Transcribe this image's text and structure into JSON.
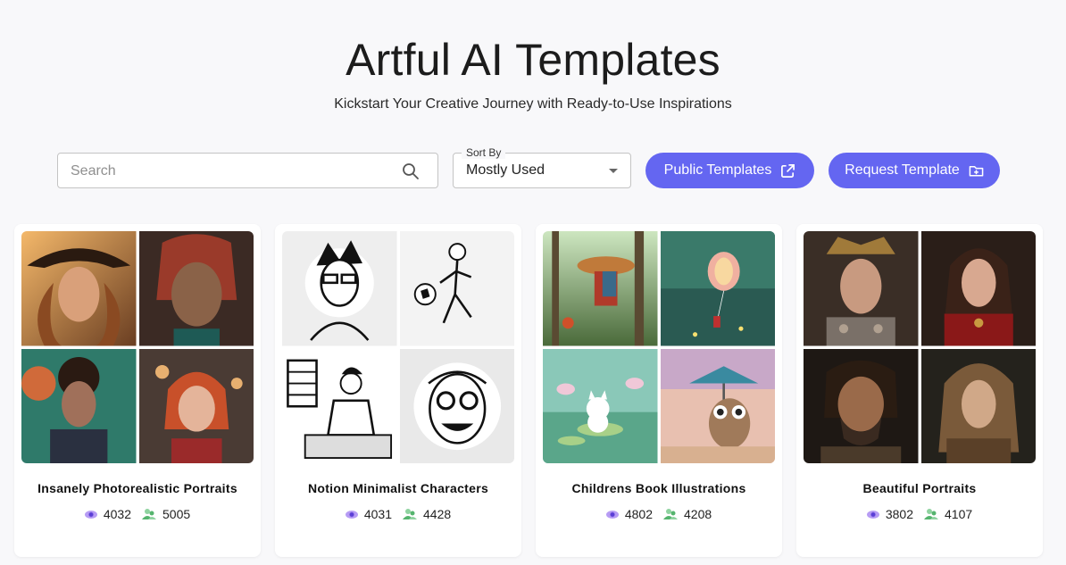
{
  "header": {
    "title": "Artful AI Templates",
    "subtitle": "Kickstart Your Creative Journey with Ready-to-Use Inspirations"
  },
  "search": {
    "placeholder": "Search",
    "value": ""
  },
  "sort": {
    "label": "Sort By",
    "selected": "Mostly Used"
  },
  "buttons": {
    "public_templates": "Public Templates",
    "request_template": "Request Template"
  },
  "icons": {
    "search": "search-icon",
    "external_link": "external-link-icon",
    "folder_add": "folder-plus-icon",
    "views": "eye-icon",
    "uses": "users-icon"
  },
  "colors": {
    "accent": "#6466f1",
    "views_icon": "#9b7cf0",
    "uses_icon": "#55b46e"
  },
  "cards": [
    {
      "title": "Insanely Photorealistic Portraits",
      "views": "4032",
      "uses": "5005"
    },
    {
      "title": "Notion Minimalist Characters",
      "views": "4031",
      "uses": "4428"
    },
    {
      "title": "Childrens Book Illustrations",
      "views": "4802",
      "uses": "4208"
    },
    {
      "title": "Beautiful Portraits",
      "views": "3802",
      "uses": "4107"
    }
  ]
}
